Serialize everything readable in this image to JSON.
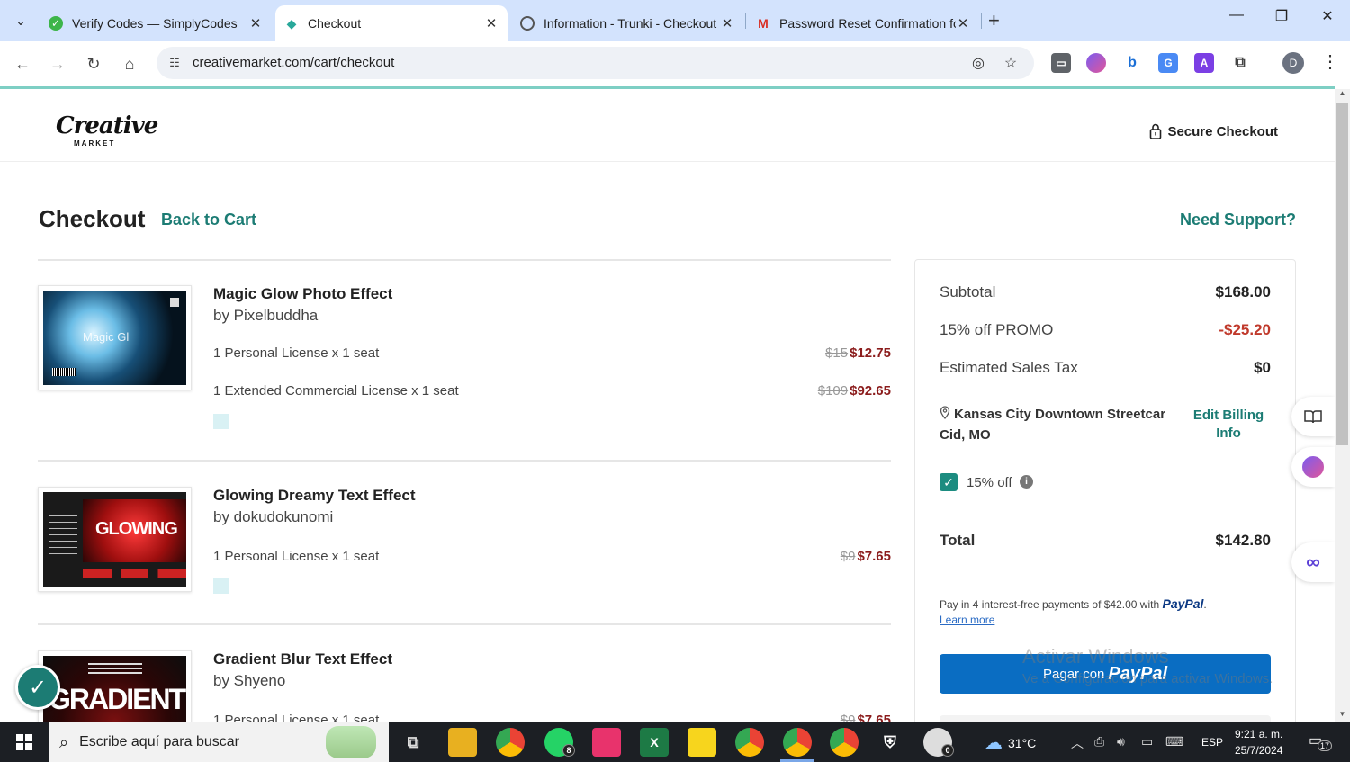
{
  "browser": {
    "tabs": [
      {
        "title": "Verify Codes — SimplyCodes",
        "active": false,
        "favicon": "simplycodes-icon"
      },
      {
        "title": "Checkout",
        "active": true,
        "favicon": "creativemarket-icon"
      },
      {
        "title": "Information - Trunki - Checkout",
        "active": false,
        "favicon": "globe-icon"
      },
      {
        "title": "Password Reset Confirmation fo",
        "active": false,
        "favicon": "gmail-icon"
      }
    ],
    "url": "creativemarket.com/cart/checkout",
    "profile_initial": "D"
  },
  "header": {
    "logo_word": "Creative",
    "logo_sub": "MARKET",
    "secure_label": "Secure Checkout"
  },
  "page": {
    "title": "Checkout",
    "back_link": "Back to Cart",
    "support_link": "Need Support?"
  },
  "cart": {
    "items": [
      {
        "title": "Magic Glow Photo Effect",
        "author": "by Pixelbuddha",
        "thumb_text": "Magic Gl",
        "licenses": [
          {
            "label": "1 Personal License x 1 seat",
            "old_price": "$15",
            "price": "$12.75"
          },
          {
            "label": "1 Extended Commercial License x 1 seat",
            "old_price": "$109",
            "price": "$92.65"
          }
        ]
      },
      {
        "title": "Glowing Dreamy Text Effect",
        "author": "by dokudokunomi",
        "thumb_text": "GLOWING",
        "licenses": [
          {
            "label": "1 Personal License x 1 seat",
            "old_price": "$9",
            "price": "$7.65"
          }
        ]
      },
      {
        "title": "Gradient Blur Text Effect",
        "author": "by Shyeno",
        "thumb_text": "GRADIENT",
        "licenses": [
          {
            "label": "1 Personal License x 1 seat",
            "old_price": "$9",
            "price": "$7.65"
          }
        ]
      }
    ]
  },
  "summary": {
    "subtotal_label": "Subtotal",
    "subtotal": "$168.00",
    "promo_label": "15% off PROMO",
    "promo_value": "-$25.20",
    "tax_label": "Estimated Sales Tax",
    "tax_value": "$0",
    "address_line1": "Kansas City Downtown Streetcar",
    "address_line2": "Cid, MO",
    "edit_billing": "Edit Billing Info",
    "promo_checkbox_label": "15% off",
    "total_label": "Total",
    "total_value": "$142.80",
    "paypal_note": "Pay in 4 interest-free payments of $42.00 with",
    "paypal_brand": "PayPal",
    "learn_more": "Learn more",
    "paypal_button_prefix": "Pagar con",
    "paypal_button_brand": "PayPal"
  },
  "watermark": {
    "line1": "Activar Windows",
    "line2": "Ve a Configuración para activar Windows."
  },
  "taskbar": {
    "search_placeholder": "Escribe aquí para buscar",
    "whatsapp_badge": "8",
    "app_badge": "0",
    "temperature": "31°C",
    "language": "ESP",
    "time": "9:21 a. m.",
    "date": "25/7/2024",
    "notifications": "17"
  },
  "colors": {
    "accent": "#1c7c74",
    "price_red": "#8b1c1c",
    "promo_red": "#c0392b",
    "paypal_blue": "#0a6dc2",
    "tabbar": "#d3e3fd"
  }
}
